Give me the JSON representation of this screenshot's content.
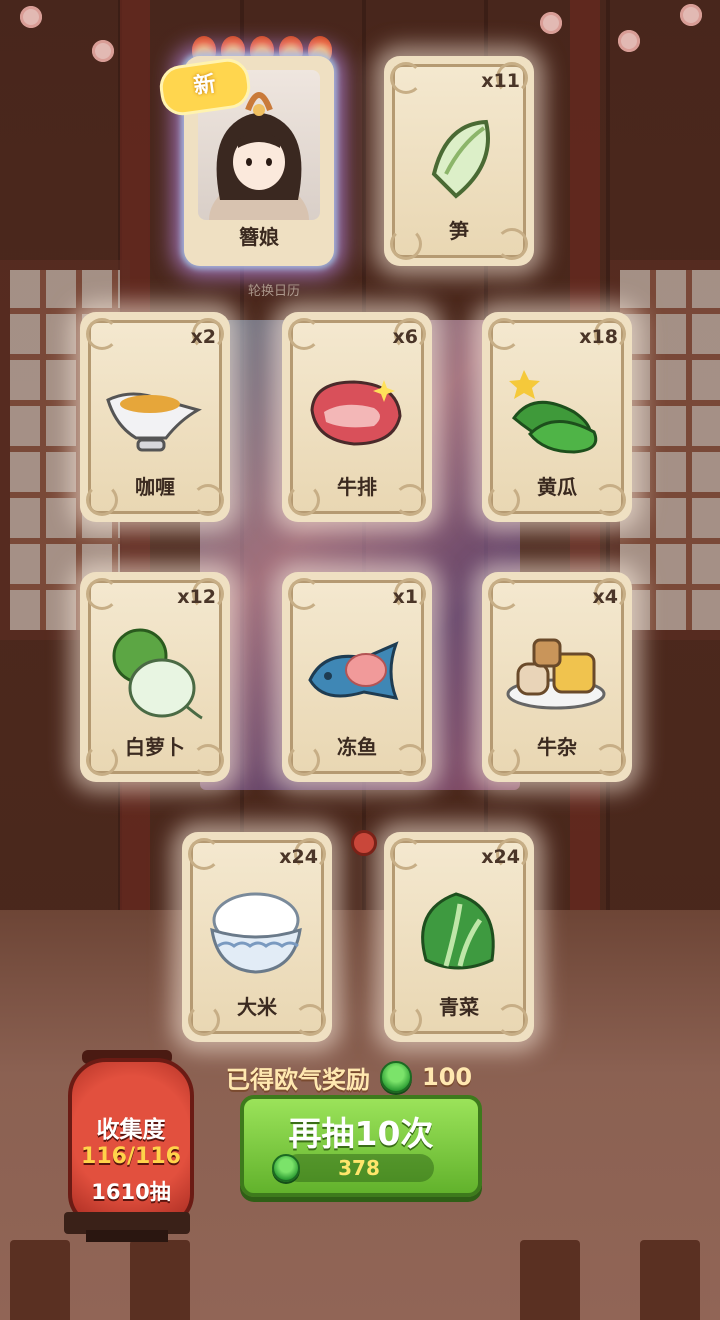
{
  "top_card": {
    "name": "簪娘",
    "badge": "新",
    "stars": 5,
    "sublabel": "轮换日历"
  },
  "cards": [
    {
      "id": "sun",
      "name": "笋",
      "count": "x11",
      "icon": "bamboo-shoot-icon"
    },
    {
      "id": "curry",
      "name": "咖喱",
      "count": "x2",
      "icon": "gravy-boat-icon"
    },
    {
      "id": "steak",
      "name": "牛排",
      "count": "x6",
      "icon": "steak-icon"
    },
    {
      "id": "cucumber",
      "name": "黄瓜",
      "count": "x18",
      "icon": "cucumber-icon"
    },
    {
      "id": "radish",
      "name": "白萝卜",
      "count": "x12",
      "icon": "white-radish-icon"
    },
    {
      "id": "fish",
      "name": "冻鱼",
      "count": "x1",
      "icon": "frozen-fish-icon"
    },
    {
      "id": "tripe",
      "name": "牛杂",
      "count": "x4",
      "icon": "beef-offal-icon"
    },
    {
      "id": "rice",
      "name": "大米",
      "count": "x24",
      "icon": "rice-bowl-icon"
    },
    {
      "id": "greens",
      "name": "青菜",
      "count": "x24",
      "icon": "bok-choy-icon"
    }
  ],
  "reward": {
    "label": "已得欧气奖励",
    "value": "100"
  },
  "draw_button": {
    "label": "再抽10次",
    "cost": "378"
  },
  "collection": {
    "title": "收集度",
    "progress": "116/116",
    "pulls": "1610抽"
  },
  "colors": {
    "button_green": "#62b22c",
    "lantern_red": "#d9402f",
    "coin_green": "#2a9b32"
  }
}
